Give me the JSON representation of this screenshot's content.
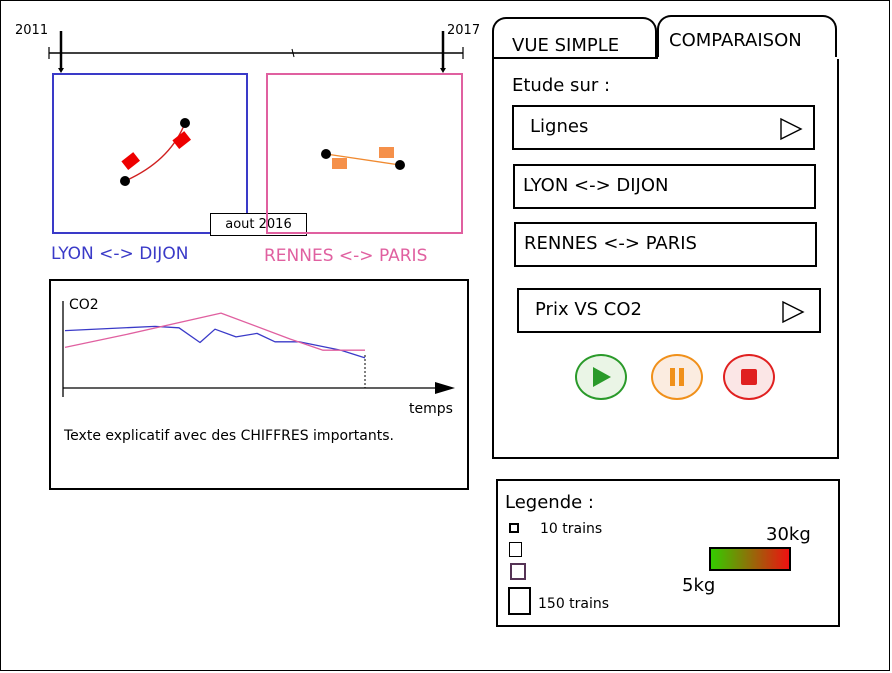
{
  "timeline": {
    "start_year": "2011",
    "end_year": "2017",
    "current_date": "aout 2016"
  },
  "maps": [
    {
      "route_label": "LYON <-> DIJON",
      "color": "#3a3ac8"
    },
    {
      "route_label": "RENNES <-> PARIS",
      "color": "#e060a0"
    }
  ],
  "chart_panel": {
    "ylabel": "CO2",
    "xlabel": "temps",
    "description": "Texte explicatif avec des CHIFFRES importants.",
    "chart_data": {
      "type": "line",
      "ylabel": "CO2",
      "xlabel": "temps",
      "grid": false,
      "series": [
        {
          "color": "#3a3ac8",
          "points": [
            [
              0,
              0.72
            ],
            [
              0.3,
              0.78
            ],
            [
              0.38,
              0.76
            ],
            [
              0.45,
              0.55
            ],
            [
              0.5,
              0.74
            ],
            [
              0.57,
              0.63
            ],
            [
              0.64,
              0.68
            ],
            [
              0.7,
              0.56
            ],
            [
              0.78,
              0.56
            ],
            [
              0.92,
              0.44
            ],
            [
              1,
              0.33
            ]
          ]
        },
        {
          "color": "#e060a0",
          "points": [
            [
              0,
              0.48
            ],
            [
              0.2,
              0.66
            ],
            [
              0.52,
              0.97
            ],
            [
              0.75,
              0.6
            ],
            [
              0.86,
              0.44
            ],
            [
              1,
              0.44
            ]
          ]
        }
      ]
    }
  },
  "tabs": [
    {
      "label": "VUE SIMPLE"
    },
    {
      "label": "COMPARAISON"
    }
  ],
  "controls": {
    "study_label": "Etude sur :",
    "study_select": "Lignes",
    "route_1": "LYON <-> DIJON",
    "route_2": "RENNES <-> PARIS",
    "metric_select": "Prix VS CO2"
  },
  "playback": {
    "play_color": "#2a9a2a",
    "pause_color": "#f0901a",
    "stop_color": "#e02020"
  },
  "legend": {
    "title": "Legende :",
    "min_trains": "10 trains",
    "max_trains": "150 trains",
    "max_co2": "30kg",
    "min_co2": "5kg",
    "gradient_start": "#33cc00",
    "gradient_end": "#ee1111"
  }
}
